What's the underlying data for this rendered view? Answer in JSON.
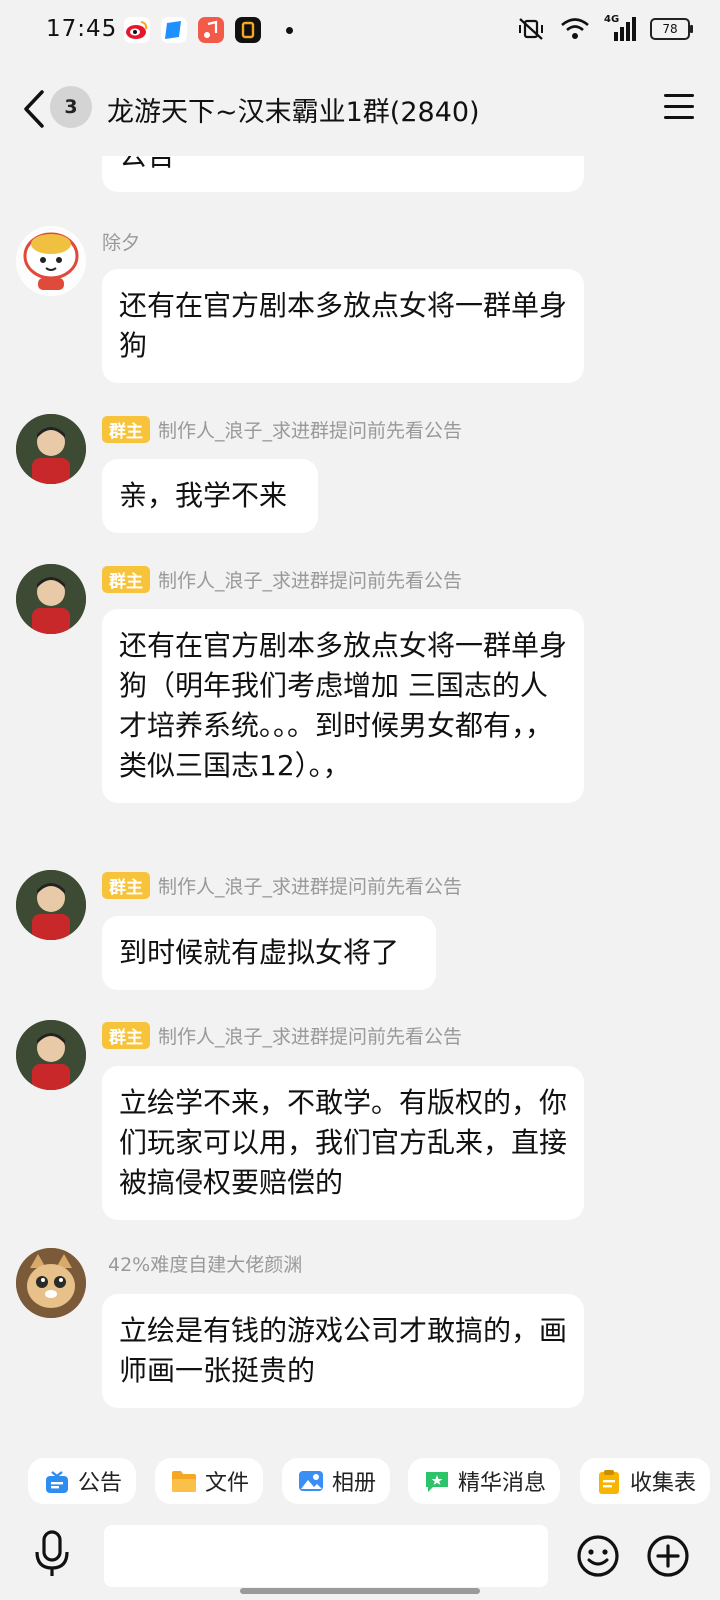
{
  "status_bar": {
    "time": "17:45",
    "battery": "78",
    "network": "4G",
    "notification_icons": [
      "weibo-icon",
      "blue-app-icon",
      "music-app-icon",
      "black-app-icon"
    ]
  },
  "header": {
    "back_count": "3",
    "title": "龙游天下~汉末霸业1群(2840)"
  },
  "messages": [
    {
      "text": "公告"
    },
    {
      "sender": "除夕",
      "text": "还有在官方剧本多放点女将一群单身狗"
    },
    {
      "badge": "群主",
      "sender": "制作人_浪子_求进群提问前先看公告",
      "text": "亲，我学不来"
    },
    {
      "badge": "群主",
      "sender": "制作人_浪子_求进群提问前先看公告",
      "text": "还有在官方剧本多放点女将一群单身狗（明年我们考虑增加 三国志的人才培养系统。。。到时候男女都有，，类似三国志12）。，"
    },
    {
      "badge": "群主",
      "sender": "制作人_浪子_求进群提问前先看公告",
      "text": "到时候就有虚拟女将了"
    },
    {
      "badge": "群主",
      "sender": "制作人_浪子_求进群提问前先看公告",
      "text": "立绘学不来，不敢学。有版权的，你们玩家可以用，我们官方乱来，直接被搞侵权要赔偿的"
    },
    {
      "sender": "42%难度自建大佬颜渊",
      "text": "立绘是有钱的游戏公司才敢搞的，画师画一张挺贵的"
    }
  ],
  "quick_bar": {
    "items": [
      {
        "label": "公告",
        "icon": "announcement-icon",
        "color": "#2f8cf0"
      },
      {
        "label": "文件",
        "icon": "folder-icon",
        "color": "#f5a623"
      },
      {
        "label": "相册",
        "icon": "album-icon",
        "color": "#3a8ff5"
      },
      {
        "label": "精华消息",
        "icon": "essence-icon",
        "color": "#2dc36a"
      },
      {
        "label": "收集表",
        "icon": "form-icon",
        "color": "#f7b500"
      }
    ]
  },
  "input_bar": {
    "placeholder": ""
  },
  "colors": {
    "background": "#f2f2f2",
    "bubble": "#ffffff",
    "owner_badge": "#f7c33a"
  }
}
